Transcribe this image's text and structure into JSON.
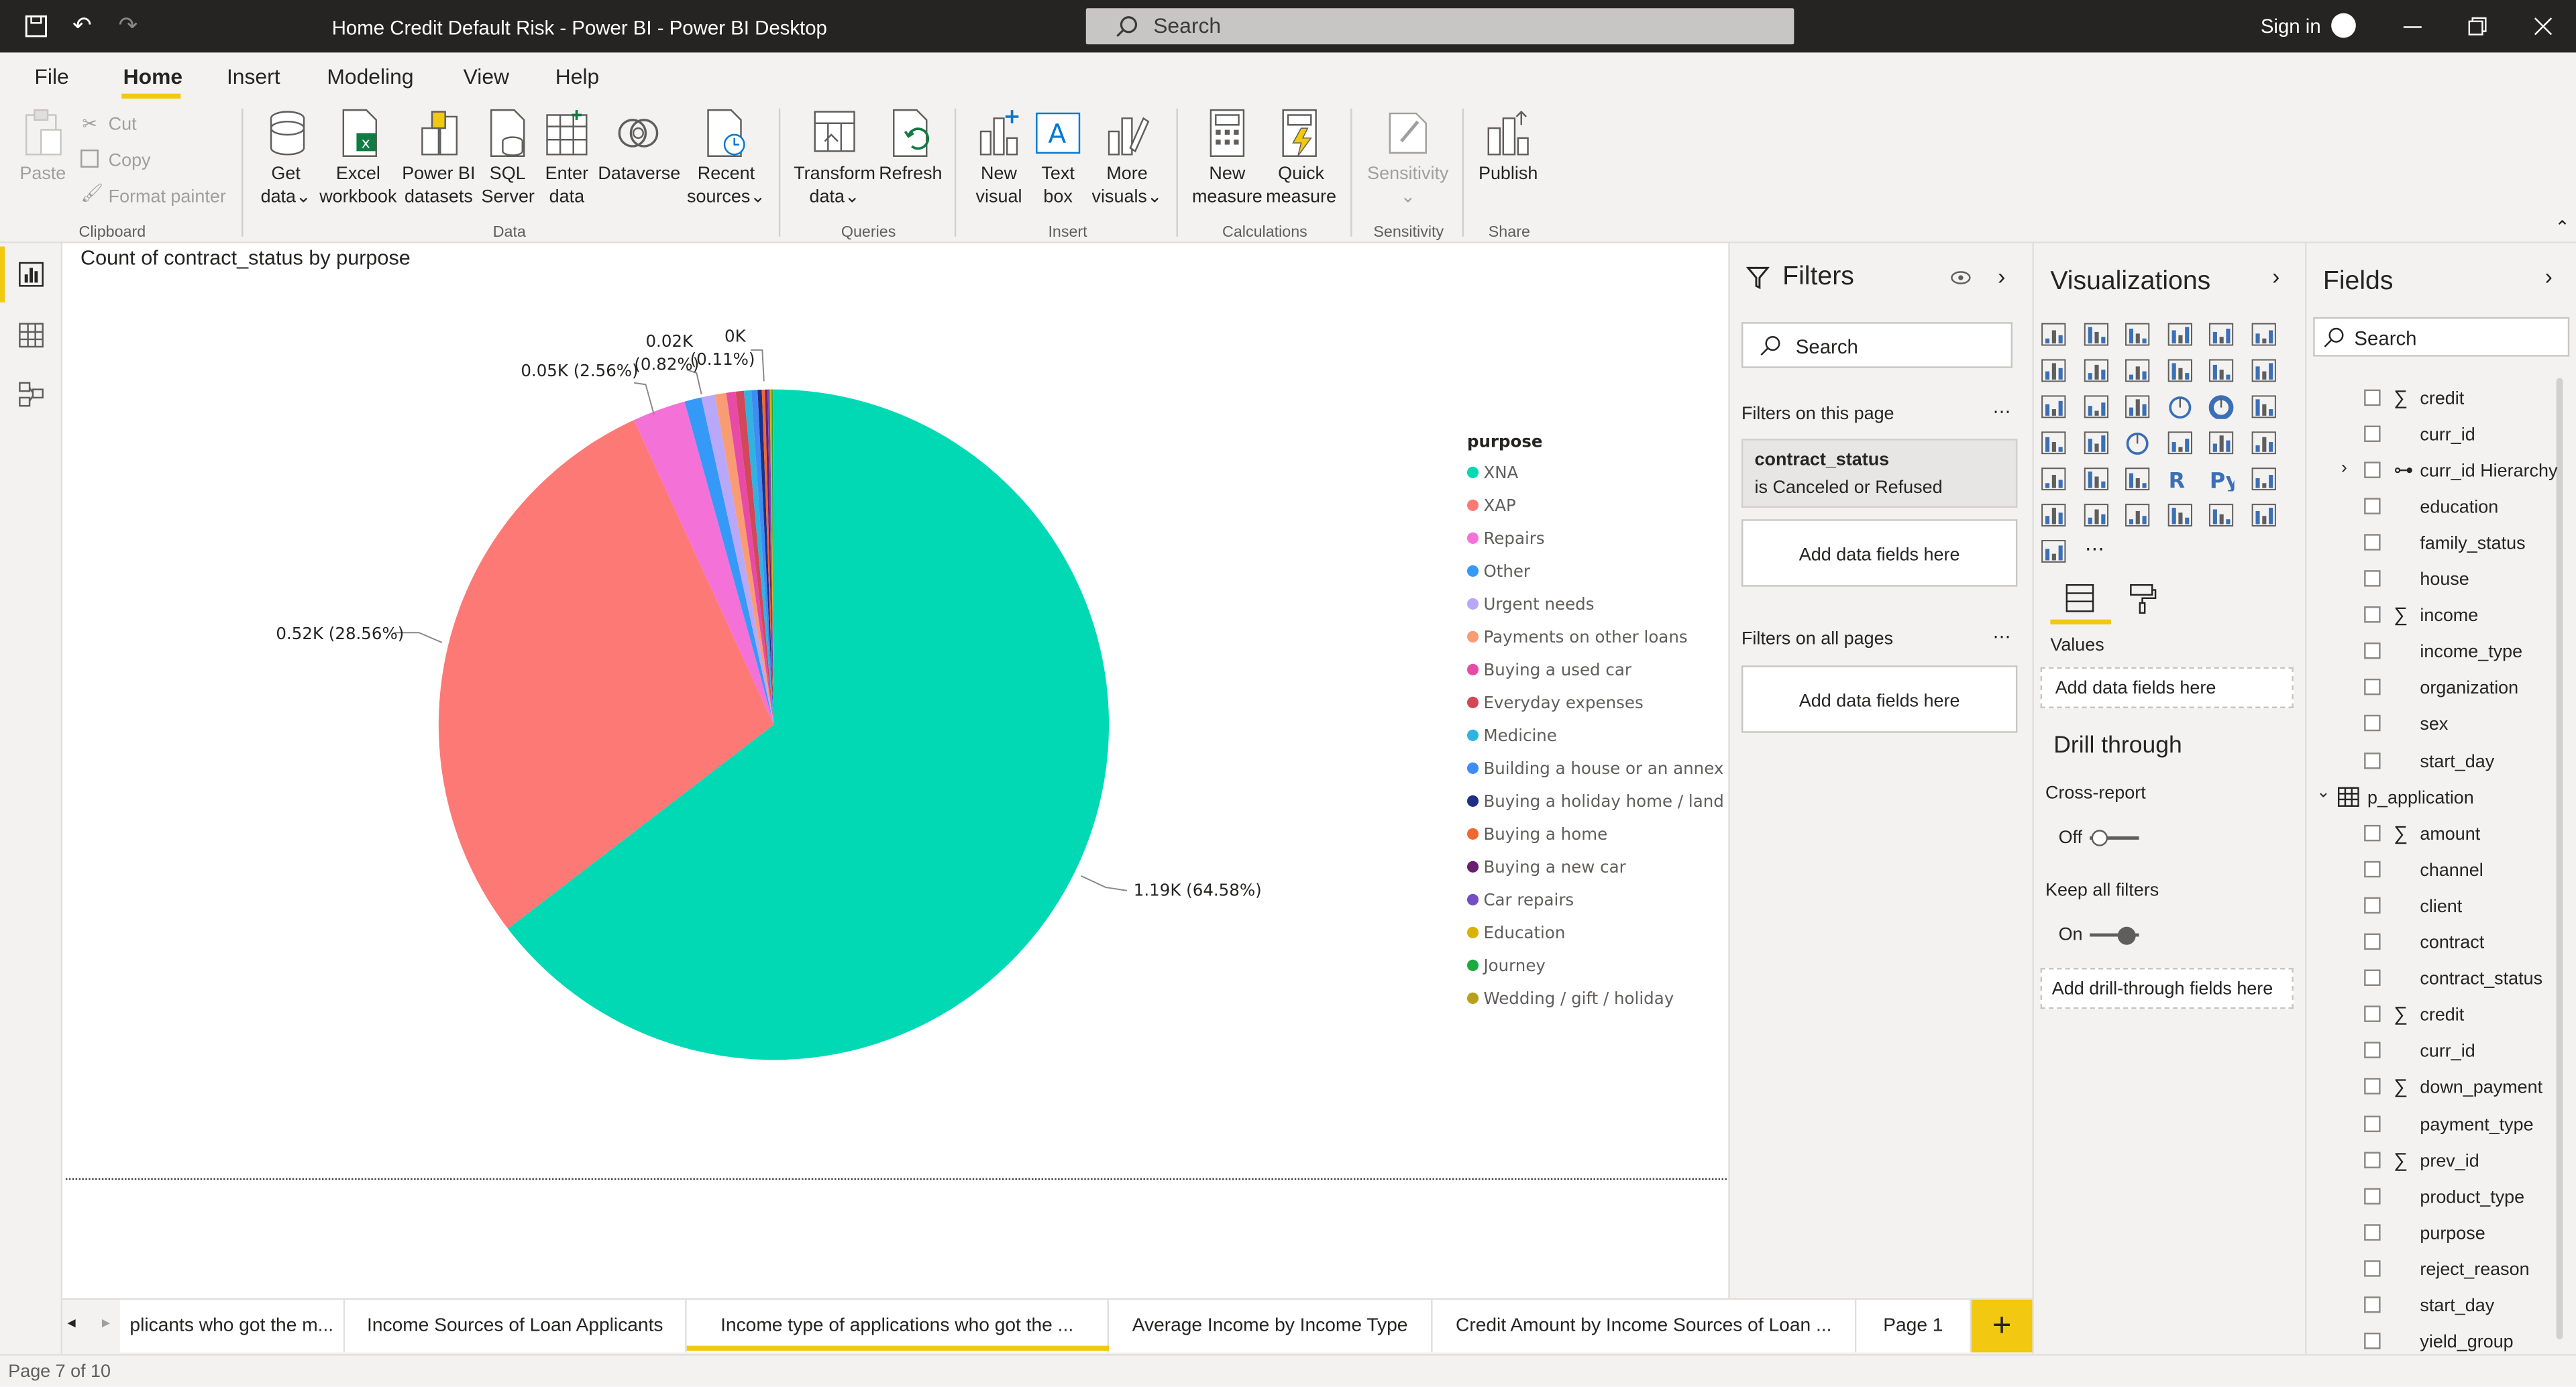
{
  "window": {
    "title": "Home Credit Default Risk - Power BI - Power BI Desktop",
    "search_placeholder": "Search",
    "sign_in": "Sign in"
  },
  "menu": {
    "items": [
      "File",
      "Home",
      "Insert",
      "Modeling",
      "View",
      "Help"
    ],
    "active": "Home"
  },
  "ribbon": {
    "clipboard": {
      "paste": "Paste",
      "cut": "Cut",
      "copy": "Copy",
      "format_painter": "Format painter",
      "group": "Clipboard"
    },
    "data": {
      "get_data": [
        "Get",
        "data"
      ],
      "excel": [
        "Excel",
        "workbook"
      ],
      "pbi_datasets": [
        "Power BI",
        "datasets"
      ],
      "sql": [
        "SQL",
        "Server"
      ],
      "enter": [
        "Enter",
        "data"
      ],
      "dataverse": "Dataverse",
      "recent": [
        "Recent",
        "sources"
      ],
      "group": "Data"
    },
    "queries": {
      "transform": [
        "Transform",
        "data"
      ],
      "refresh": "Refresh",
      "group": "Queries"
    },
    "insert": {
      "new_visual": [
        "New",
        "visual"
      ],
      "text_box": [
        "Text",
        "box"
      ],
      "more_visuals": [
        "More",
        "visuals"
      ],
      "group": "Insert"
    },
    "calculations": {
      "new_measure": [
        "New",
        "measure"
      ],
      "quick_measure": [
        "Quick",
        "measure"
      ],
      "group": "Calculations"
    },
    "sensitivity": {
      "label": "Sensitivity",
      "group": "Sensitivity"
    },
    "share": {
      "publish": "Publish",
      "group": "Share"
    }
  },
  "chart": {
    "title": "Count of contract_status by purpose",
    "legend_title": "purpose",
    "labels": {
      "xna": "1.19K (64.58%)",
      "xap": "0.52K (28.56%)",
      "repairs": "0.05K (2.56%)",
      "other_k": "0.02K",
      "other_pct": "(0.82%)",
      "tiny_k": "0K",
      "tiny_pct": "(0.11%)"
    }
  },
  "chart_data": {
    "type": "pie",
    "title": "Count of contract_status by purpose",
    "legend_title": "purpose",
    "legend_position": "right",
    "categories": [
      "XNA",
      "XAP",
      "Repairs",
      "Other",
      "Urgent needs",
      "Payments on other loans",
      "Buying a used car",
      "Everyday expenses",
      "Medicine",
      "Building a house or an annex",
      "Buying a holiday home / land",
      "Buying a home",
      "Buying a new car",
      "Car repairs",
      "Education",
      "Journey",
      "Wedding / gift / holiday"
    ],
    "percent": [
      64.58,
      28.56,
      2.56,
      0.82,
      0.65,
      0.55,
      0.45,
      0.4,
      0.35,
      0.3,
      0.2,
      0.15,
      0.12,
      0.11,
      0.08,
      0.06,
      0.05
    ],
    "colors": [
      "#01D9B5",
      "#FD7976",
      "#F471D8",
      "#3599F8",
      "#B9A7FA",
      "#FA9C73",
      "#E74BA7",
      "#D2475A",
      "#2FB3E1",
      "#3F8CF5",
      "#1F2F87",
      "#F0682F",
      "#6B1D6F",
      "#744EC2",
      "#D9B300",
      "#1AAB40",
      "#B9A01A"
    ]
  },
  "filters": {
    "title": "Filters",
    "search_placeholder": "Search",
    "on_this_page": "Filters on this page",
    "card_field": "contract_status",
    "card_condition": "is Canceled or Refused",
    "add_fields": "Add data fields here",
    "on_all_pages": "Filters on all pages",
    "add_fields_all": "Add data fields here"
  },
  "visualizations": {
    "title": "Visualizations",
    "values_label": "Values",
    "add_fields": "Add data fields here",
    "drill_through": "Drill through",
    "cross_report": "Cross-report",
    "off": "Off",
    "keep_all_filters": "Keep all filters",
    "on": "On",
    "add_drill": "Add drill-through fields here"
  },
  "fields": {
    "title": "Fields",
    "search_placeholder": "Search",
    "group1": [
      {
        "name": "credit",
        "sigma": true
      },
      {
        "name": "curr_id",
        "sigma": false
      },
      {
        "name": "curr_id Hierarchy",
        "sigma": false,
        "hierarchy": true
      },
      {
        "name": "education",
        "sigma": false
      },
      {
        "name": "family_status",
        "sigma": false
      },
      {
        "name": "house",
        "sigma": false
      },
      {
        "name": "income",
        "sigma": true
      },
      {
        "name": "income_type",
        "sigma": false
      },
      {
        "name": "organization",
        "sigma": false
      },
      {
        "name": "sex",
        "sigma": false
      },
      {
        "name": "start_day",
        "sigma": false
      }
    ],
    "table_name": "p_application",
    "group2": [
      {
        "name": "amount",
        "sigma": true
      },
      {
        "name": "channel",
        "sigma": false
      },
      {
        "name": "client",
        "sigma": false
      },
      {
        "name": "contract",
        "sigma": false
      },
      {
        "name": "contract_status",
        "sigma": false
      },
      {
        "name": "credit",
        "sigma": true
      },
      {
        "name": "curr_id",
        "sigma": false
      },
      {
        "name": "down_payment",
        "sigma": true
      },
      {
        "name": "payment_type",
        "sigma": false
      },
      {
        "name": "prev_id",
        "sigma": true
      },
      {
        "name": "product_type",
        "sigma": false
      },
      {
        "name": "purpose",
        "sigma": false
      },
      {
        "name": "reject_reason",
        "sigma": false
      },
      {
        "name": "start_day",
        "sigma": false
      },
      {
        "name": "yield_group",
        "sigma": false
      }
    ]
  },
  "tabs": [
    "plicants who got the m...",
    "Income Sources of Loan Applicants",
    "Income type of applications who got the ...",
    "Average Income by Income Type",
    "Credit Amount by Income Sources of Loan ...",
    "Page 1"
  ],
  "status": {
    "page": "Page 7 of 10"
  }
}
